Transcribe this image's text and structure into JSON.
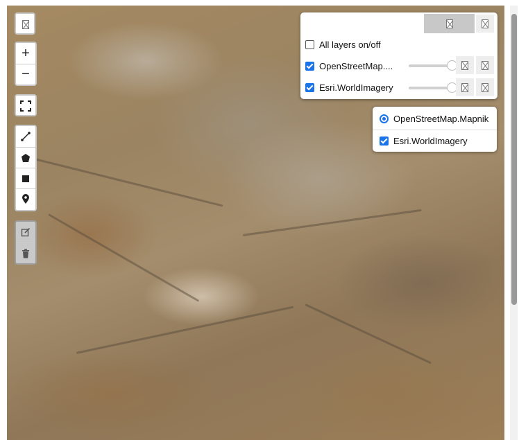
{
  "map": {
    "imagery": "Esri.WorldImagery satellite tiles (arid terrain)",
    "controls": {
      "top_icon": "broken-image-icon",
      "zoom_in_label": "+",
      "zoom_out_label": "−",
      "fullscreen_icon": "fullscreen-icon",
      "draw_tools": [
        "polyline-icon",
        "polygon-icon",
        "rectangle-icon",
        "marker-icon"
      ],
      "edit_tools": [
        "edit-icon",
        "trash-icon"
      ]
    }
  },
  "layer_panel": {
    "all_layers_label": "All layers on/off",
    "all_layers_checked": false,
    "layers": [
      {
        "label": "OpenStreetMap....",
        "checked": true,
        "opacity": 1.0
      },
      {
        "label": "Esri.WorldImagery",
        "checked": true,
        "opacity": 1.0
      }
    ]
  },
  "base_panel": {
    "base_layer": {
      "label": "OpenStreetMap.Mapnik",
      "selected": true
    },
    "overlay": {
      "label": "Esri.WorldImagery",
      "checked": true
    }
  },
  "colors": {
    "accent": "#1a73e8"
  }
}
